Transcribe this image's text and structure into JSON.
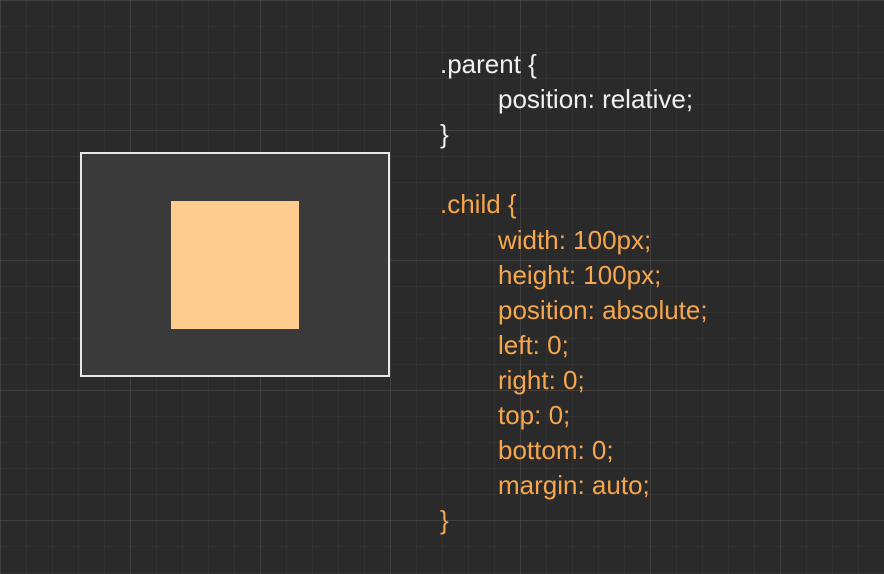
{
  "code": {
    "parent": {
      "selector": ".parent {",
      "lines": [
        "position: relative;"
      ],
      "close": "}"
    },
    "child": {
      "selector": ".child {",
      "lines": [
        "width: 100px;",
        "height: 100px;",
        "position: absolute;",
        "left: 0;",
        "right: 0;",
        "top: 0;",
        "bottom: 0;",
        "margin: auto;"
      ],
      "close": "}"
    }
  },
  "colors": {
    "childBox": "#ffcc8f",
    "parentBox": "#3a3a3a",
    "parentText": "#f0f0f0",
    "childText": "#f6a64d"
  }
}
